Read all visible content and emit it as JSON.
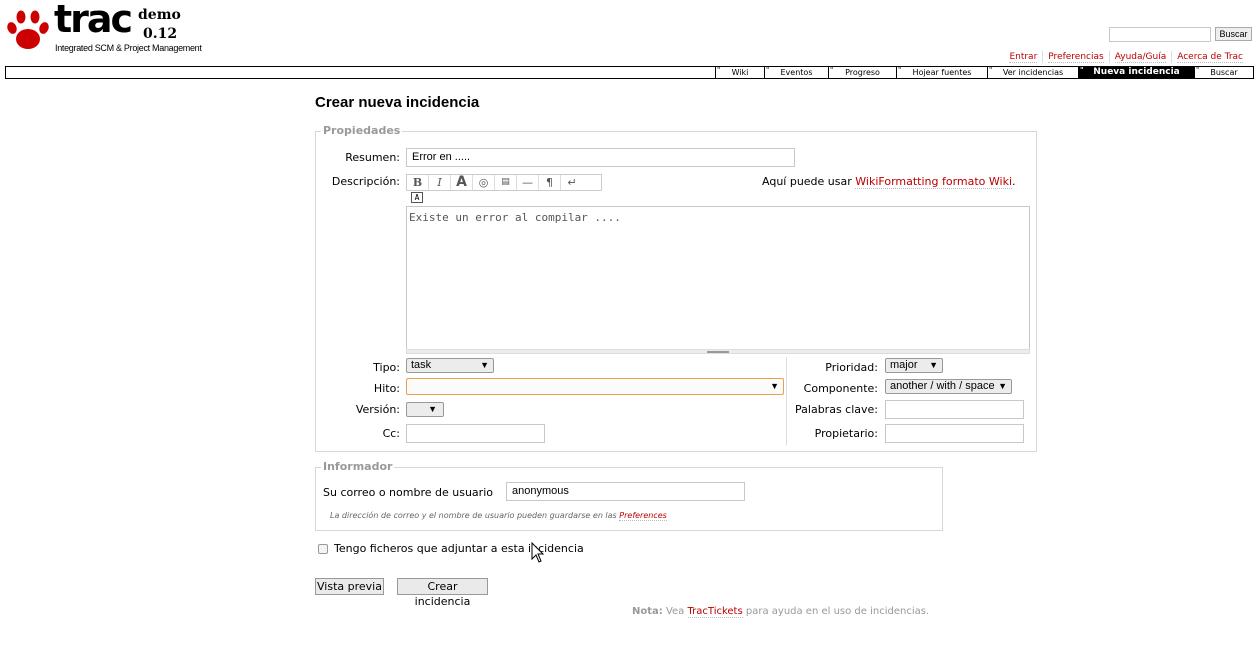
{
  "header": {
    "logo_text": "trac",
    "logo_demo": "demo",
    "logo_version": "0.12",
    "logo_subtitle": "Integrated SCM & Project Management",
    "search_button": "Buscar",
    "search_value": ""
  },
  "metanav": [
    "Entrar",
    "Preferencias",
    "Ayuda/Guía",
    "Acerca de Trac"
  ],
  "mainnav": [
    {
      "label": "Wiki",
      "active": false
    },
    {
      "label": "Eventos",
      "active": false
    },
    {
      "label": "Progreso",
      "active": false
    },
    {
      "label": "Hojear fuentes",
      "active": false
    },
    {
      "label": "Ver incidencias",
      "active": false
    },
    {
      "label": "Nueva incidencia",
      "active": true
    },
    {
      "label": "Buscar",
      "active": false
    }
  ],
  "page_title": "Crear nueva incidencia",
  "properties": {
    "legend": "Propiedades",
    "summary_label": "Resumen:",
    "summary_value": "Error en .....",
    "description_label": "Descripción:",
    "wiki_hint_prefix": "Aquí puede usar",
    "wiki_hint_link": "WikiFormatting formato Wiki",
    "wiki_hint_suffix": ".",
    "toolbar_icons": [
      "bold-icon",
      "italic-icon",
      "heading-icon",
      "link-icon",
      "code-icon",
      "hr-icon",
      "paragraph-icon",
      "linebreak-icon",
      "monospace-icon"
    ],
    "description_value": "Existe un error al compilar ....",
    "type_label": "Tipo:",
    "type_value": "task",
    "milestone_label": "Hito:",
    "milestone_value": "",
    "version_label": "Versión:",
    "version_value": "",
    "cc_label": "Cc:",
    "cc_value": "",
    "priority_label": "Prioridad:",
    "priority_value": "major",
    "component_label": "Componente:",
    "component_value": "another / with / space",
    "keywords_label": "Palabras clave:",
    "keywords_value": "",
    "owner_label": "Propietario:",
    "owner_value": ""
  },
  "reporter": {
    "legend": "Informador",
    "label": "Su correo o nombre de usuario",
    "value": "anonymous",
    "hint_text": "La dirección de correo y el nombre de usuario pueden guardarse en las",
    "hint_link": "Preferences"
  },
  "attachment_label": "Tengo ficheros que adjuntar a esta incidencia",
  "buttons": {
    "preview": "Vista previa",
    "create": "Crear incidencia"
  },
  "note": {
    "label": "Nota:",
    "prefix": "Vea",
    "link": "TracTickets",
    "suffix": "para ayuda en el uso de incidencias."
  },
  "colors": {
    "link": "#bb0000",
    "nav_active_bg": "#000000",
    "legend": "#999999",
    "focus_border": "#e7a04d"
  }
}
